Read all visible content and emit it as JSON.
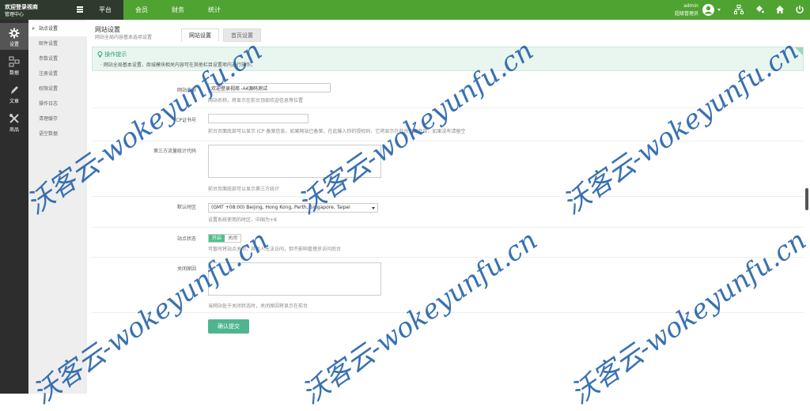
{
  "brand": {
    "title": "欢迎登录视商",
    "subtitle": "管理中心"
  },
  "nav": {
    "items": [
      "平台",
      "会员",
      "财务",
      "统计"
    ]
  },
  "user": {
    "name": "admin",
    "role": "超级管理员"
  },
  "leftbar": {
    "items": [
      {
        "label": "设置",
        "icon": "gear-icon"
      },
      {
        "label": "数据",
        "icon": "data-icon"
      },
      {
        "label": "文章",
        "icon": "pen-icon"
      },
      {
        "label": "商品",
        "icon": "tools-icon"
      }
    ]
  },
  "submenu": {
    "items": [
      "站点设置",
      "邮件设置",
      "参数设置",
      "注册设置",
      "权限设置",
      "操作日志",
      "清理缓存",
      "语空数据"
    ]
  },
  "page": {
    "title": "网站设置",
    "subtitle": "网站全局内容基本选项设置"
  },
  "tabs": [
    "网站设置",
    "首页设置"
  ],
  "tips": {
    "title": "操作提示",
    "body": "网站全局基本设置，商城模块相关内容可在其他栏目设置项内进行操作。"
  },
  "form": {
    "site_name": {
      "label": "网站名称",
      "value": "欢迎登录视商 -A4源码测试",
      "help": "网站名称，将显示在前台顶部欢迎信息等位置"
    },
    "icp": {
      "label": "ICP证书号",
      "value": "",
      "help": "前台页面底部可以显示 ICP 备案信息，如果网站已备案，在此输入你的授权码，它将显示在前台页面底部，如果没有请留空"
    },
    "stats": {
      "label": "第三方流量统计代码",
      "help": "前台页面底部可以显示第三方统计"
    },
    "timezone": {
      "label": "默认时区",
      "value": "(GMT +08:00) Beijing, Hong Kong, Perth, Singapore, Taipei",
      "help": "设置系统使用的时区，中国为+8"
    },
    "status": {
      "label": "站点状态",
      "on": "开启",
      "off": "关闭",
      "help": "可暂时将站点关闭，其他人无法访问，但不影响管理员访问后台"
    },
    "close_reason": {
      "label": "关闭原因",
      "help": "当网站处于关闭状态时，关闭原因将显示在前台"
    },
    "submit": "确认提交"
  },
  "watermark": "沃客云-wokeyunfu.cn",
  "colors": {
    "topbar": "#4fa330",
    "accent": "#4fb58e",
    "sidebar": "#2d2d2d"
  }
}
